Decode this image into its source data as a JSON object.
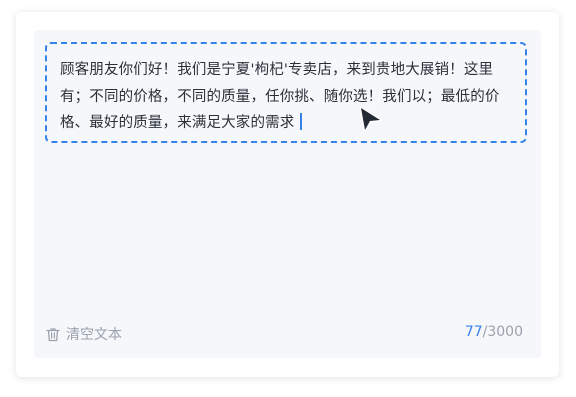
{
  "editor": {
    "content": "顾客朋友你们好！我们是宁夏'枸杞'专卖店，来到贵地大展销！这里有；不同的价格，不同的质量，任你挑、随你选！我们以；最低的价格、最好的质量，来满足大家的需求"
  },
  "footer": {
    "clear_label": "清空文本",
    "count_current": "77",
    "count_separator": "/",
    "count_max": "3000"
  },
  "icons": {
    "clear": "trash-icon",
    "cursor": "mouse-pointer-icon"
  },
  "colors": {
    "accent": "#3583e8",
    "muted": "#9ba2ad",
    "editor_bg": "#f5f7fb"
  }
}
